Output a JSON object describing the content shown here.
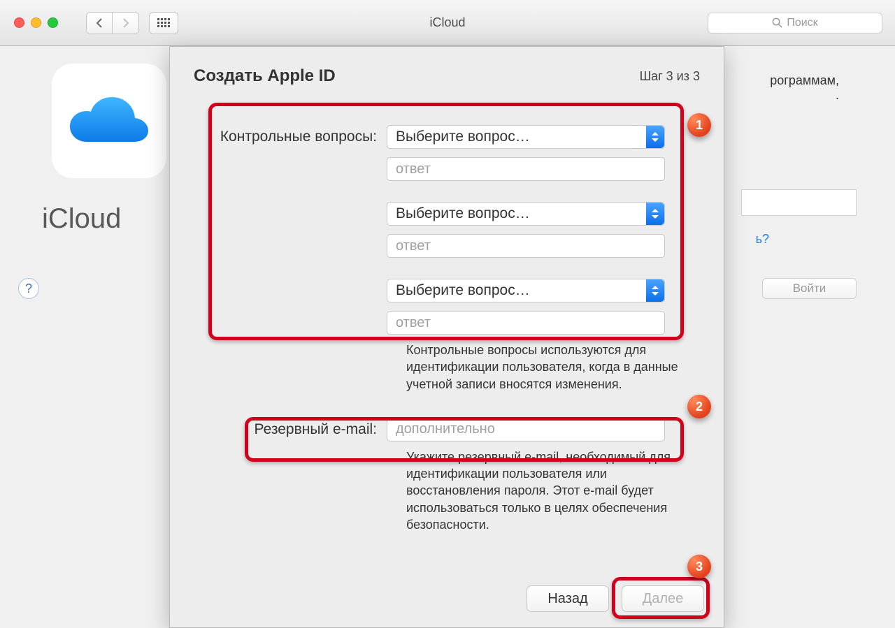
{
  "window": {
    "title": "iCloud",
    "search_placeholder": "Поиск"
  },
  "background": {
    "app_label": "iCloud",
    "right_text_1": "рограммам,",
    "right_text_2": ".",
    "forgot_link_fragment": "ь?",
    "login_button": "Войти",
    "help_label": "?"
  },
  "sheet": {
    "title": "Создать Apple ID",
    "step": "Шаг 3 из 3",
    "security_label": "Контрольные вопросы:",
    "question_placeholder": "Выберите вопрос…",
    "answer_placeholder": "ответ",
    "security_help": "Контрольные вопросы используются для идентификации пользователя, когда в данные учетной записи вносятся изменения.",
    "rescue_label": "Резервный e-mail:",
    "rescue_placeholder": "дополнительно",
    "rescue_help": "Укажите резервный e-mail, необходимый для идентификации пользователя или восстановления пароля. Этот e-mail будет использоваться только в целях обеспечения безопасности.",
    "back": "Назад",
    "next": "Далее"
  },
  "markers": {
    "m1": "1",
    "m2": "2",
    "m3": "3"
  }
}
